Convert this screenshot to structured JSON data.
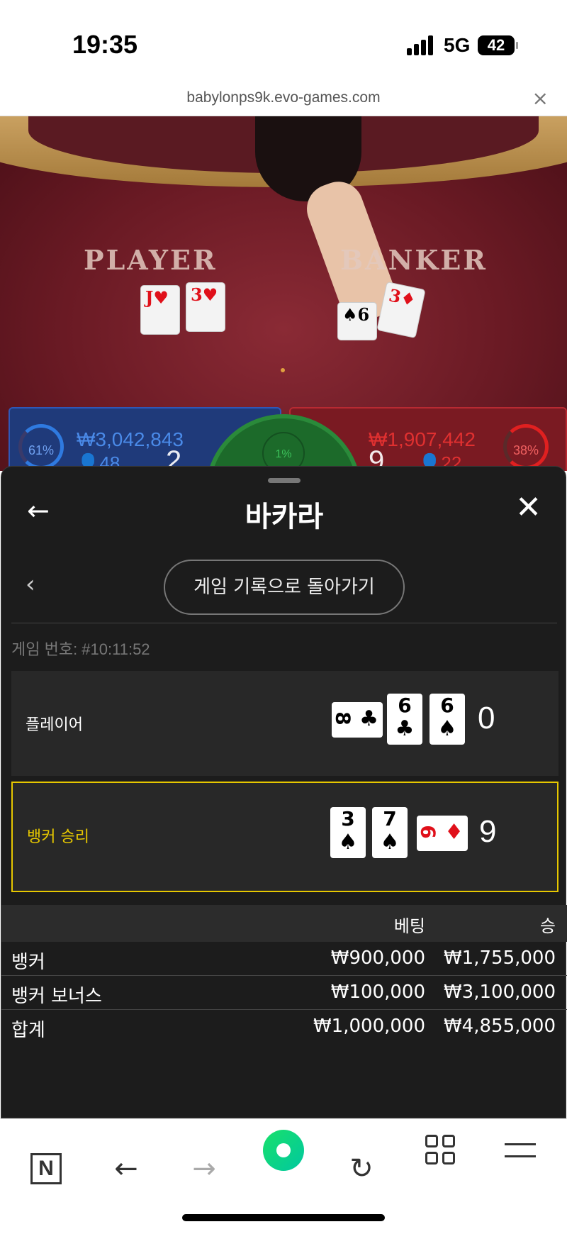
{
  "status_bar": {
    "time": "19:35",
    "network": "5G",
    "battery": "42"
  },
  "browser": {
    "url": "babylonps9k.evo-games.com",
    "close_glyph": "×"
  },
  "table": {
    "player_label": "PLAYER",
    "banker_label": "BANKER",
    "player_panel": {
      "percent": "61%",
      "amount": "₩3,042,843",
      "count": "48",
      "score": "2"
    },
    "banker_panel": {
      "percent": "38%",
      "amount": "₩1,907,442",
      "count": "22",
      "score": "9"
    },
    "tie_percent": "1%"
  },
  "sheet": {
    "back_glyph": "←",
    "title": "바카라",
    "close_glyph": "✕",
    "prev_glyph": "‹",
    "history_button": "게임 기록으로 돌아가기",
    "game_number": "게임 번호: #10:11:52",
    "player_row": {
      "label": "플레이어",
      "cards": [
        {
          "rank": "8",
          "suit": "♣",
          "color": "black",
          "rotated": true
        },
        {
          "rank": "6",
          "suit": "♣",
          "color": "black",
          "rotated": false
        },
        {
          "rank": "6",
          "suit": "♠",
          "color": "black",
          "rotated": false
        }
      ],
      "score": "0"
    },
    "banker_row": {
      "label": "뱅커 승리",
      "label_color": "#e6c700",
      "cards": [
        {
          "rank": "3",
          "suit": "♠",
          "color": "black",
          "rotated": false
        },
        {
          "rank": "7",
          "suit": "♠",
          "color": "black",
          "rotated": false
        },
        {
          "rank": "6",
          "suit": "♦",
          "color": "red",
          "rotated": true
        }
      ],
      "score": "9"
    },
    "bets_table": {
      "headers": {
        "bet": "베팅",
        "win": "승"
      },
      "rows": [
        {
          "label": "뱅커",
          "bet": "₩900,000",
          "win": "₩1,755,000"
        },
        {
          "label": "뱅커 보너스",
          "bet": "₩100,000",
          "win": "₩3,100,000"
        },
        {
          "label": "합계",
          "bet": "₩1,000,000",
          "win": "₩4,855,000"
        }
      ]
    }
  },
  "toolbar": {
    "naver_glyph": "N",
    "back_glyph": "←",
    "forward_glyph": "→",
    "refresh_glyph": "↻"
  },
  "colors": {
    "player_blue": "#2f7ae0",
    "banker_red": "#e0101a",
    "winner_yellow": "#e6c700",
    "tie_green": "#3cc05a"
  }
}
